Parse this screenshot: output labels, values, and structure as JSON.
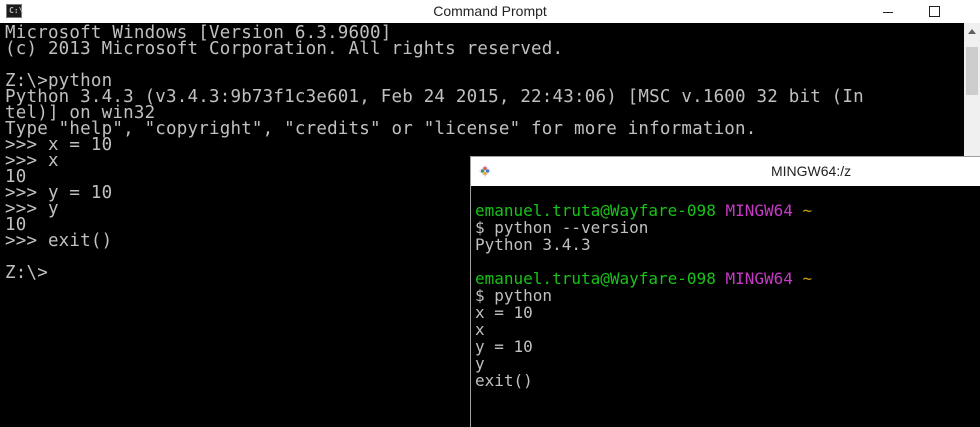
{
  "cmd": {
    "title": "Command Prompt",
    "icon_label": "C:\\",
    "lines": [
      "Microsoft Windows [Version 6.3.9600]",
      "(c) 2013 Microsoft Corporation. All rights reserved.",
      "",
      "Z:\\>python",
      "Python 3.4.3 (v3.4.3:9b73f1c3e601, Feb 24 2015, 22:43:06) [MSC v.1600 32 bit (In",
      "tel)] on win32",
      "Type \"help\", \"copyright\", \"credits\" or \"license\" for more information.",
      ">>> x = 10",
      ">>> x",
      "10",
      ">>> y = 10",
      ">>> y",
      "10",
      ">>> exit()",
      "",
      "Z:\\>"
    ],
    "icons": {
      "minimize": "minimize-icon",
      "maximize": "maximize-icon"
    }
  },
  "mingw": {
    "title": "MINGW64:/z",
    "prompt_user": "emanuel.truta@Wayfare-098",
    "prompt_env": "MINGW64",
    "prompt_dir": "~",
    "cmd1": "$ python --version",
    "out1": "Python 3.4.3",
    "cmd2": "$ python",
    "lines2": [
      "x = 10",
      "x",
      "y = 10",
      "y",
      "exit()"
    ],
    "colors": {
      "user": "#18c318",
      "env": "#c43ac4",
      "dir": "#c4a000"
    }
  }
}
